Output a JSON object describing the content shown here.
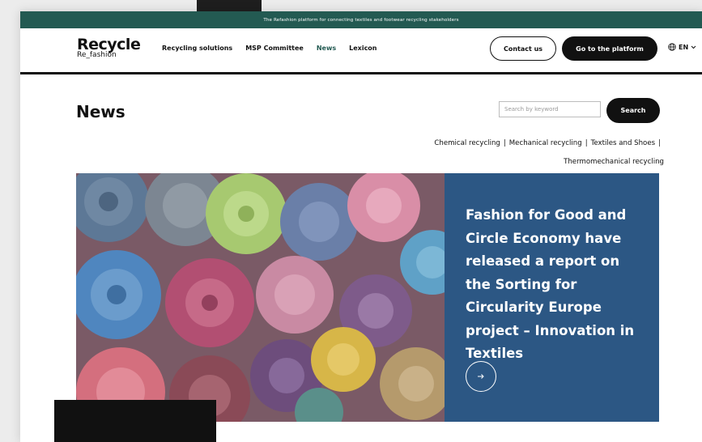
{
  "announcement": "The Refashion platform for connecting textiles and footwear recycling stakeholders",
  "logo": {
    "main": "Recycle",
    "sub": "Re_fashion"
  },
  "nav": [
    {
      "label": "Recycling solutions",
      "active": false
    },
    {
      "label": "MSP Committee",
      "active": false
    },
    {
      "label": "News",
      "active": true
    },
    {
      "label": "Lexicon",
      "active": false
    }
  ],
  "header": {
    "contact_label": "Contact us",
    "platform_label": "Go to the platform",
    "language": "EN"
  },
  "page": {
    "title": "News",
    "search_placeholder": "Search by keyword",
    "search_button": "Search"
  },
  "categories": {
    "row1": [
      "Chemical recycling",
      "Mechanical recycling",
      "Textiles and Shoes"
    ],
    "row2": [
      "Thermomechanical recycling"
    ],
    "separator": "|"
  },
  "featured": {
    "headline": "Fashion for Good and Circle Economy have released a report on the Sorting for Circularity Europe project – Innovation in Textiles",
    "arrow_icon": "arrow-right-icon",
    "image_alt": "rolled-textiles-image"
  },
  "colors": {
    "brand_green": "#235a52",
    "panel_blue": "#2c5784",
    "text": "#111111"
  }
}
